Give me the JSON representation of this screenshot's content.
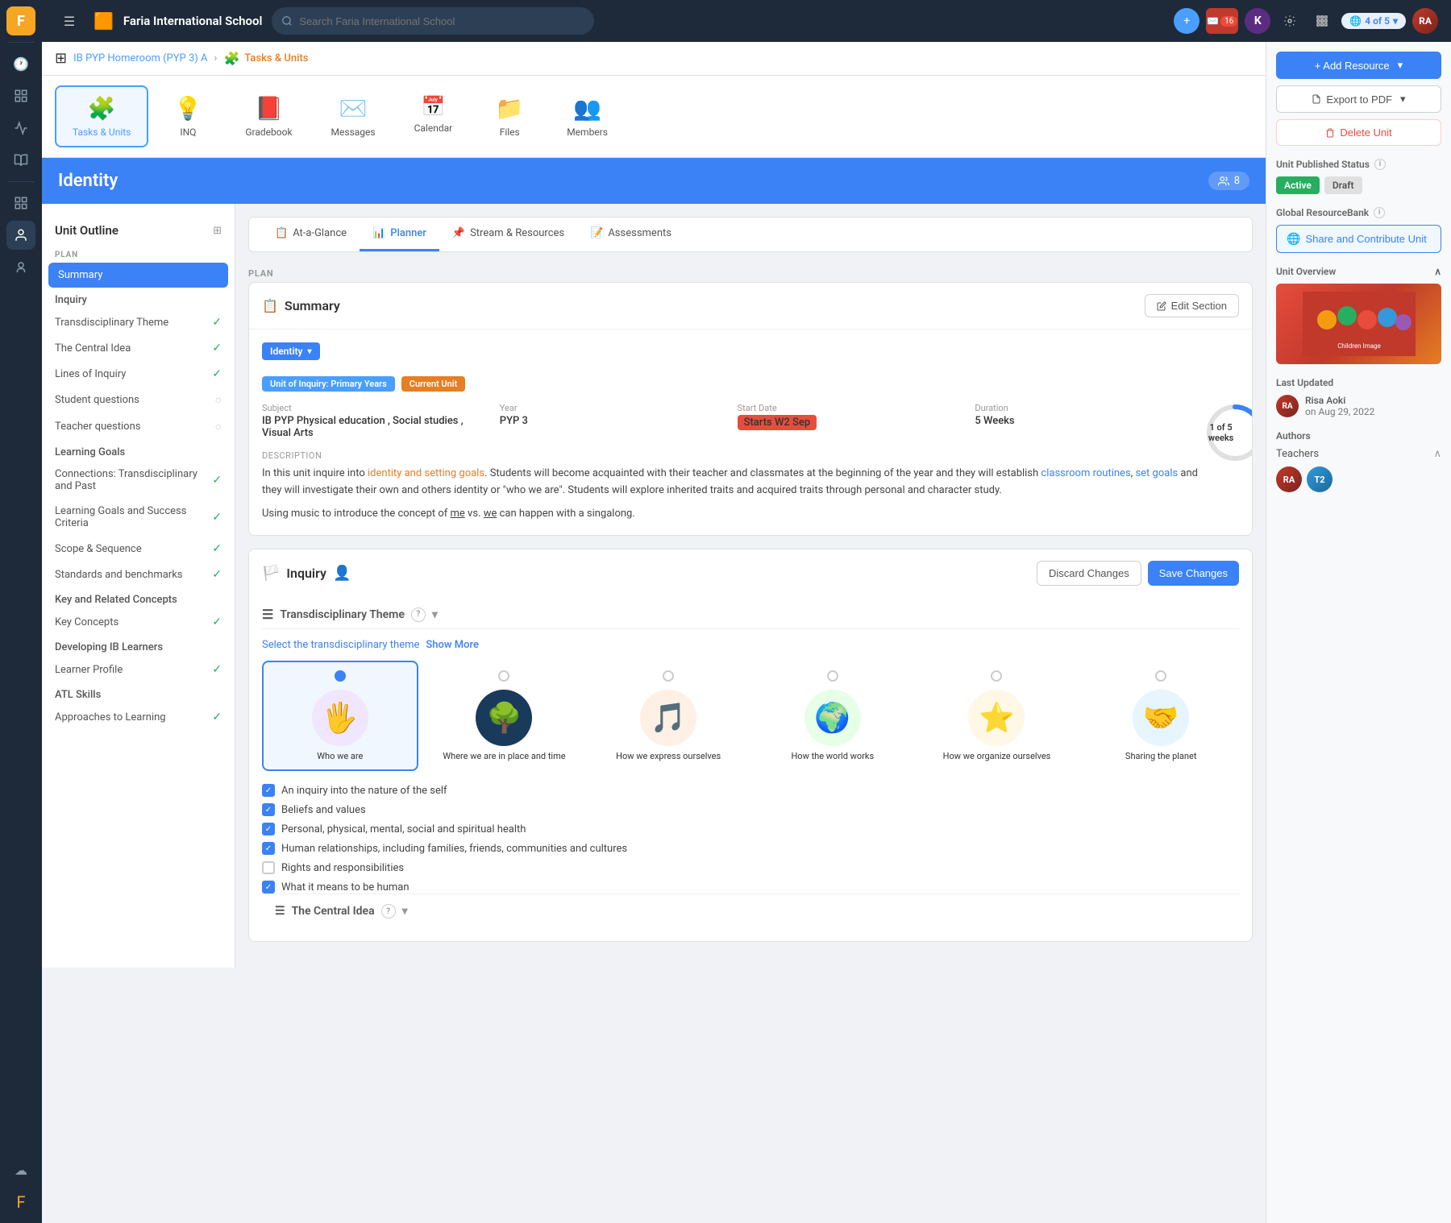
{
  "app": {
    "name": "Faria International School",
    "logo": "F"
  },
  "topbar": {
    "search_placeholder": "Search Faria International School",
    "notifications_count": "16",
    "version": "4 of 5"
  },
  "breadcrumb": {
    "parent": "IB PYP Homeroom (PYP 3) A",
    "current": "Tasks & Units"
  },
  "module_tabs": [
    {
      "id": "tasks-units",
      "label": "Tasks & Units",
      "icon": "🧩",
      "active": true
    },
    {
      "id": "inq",
      "label": "INQ",
      "icon": "💡",
      "active": false
    },
    {
      "id": "gradebook",
      "label": "Gradebook",
      "icon": "📕",
      "active": false
    },
    {
      "id": "messages",
      "label": "Messages",
      "icon": "✉️",
      "active": false
    },
    {
      "id": "calendar",
      "label": "Calendar",
      "icon": "📅",
      "active": false
    },
    {
      "id": "files",
      "label": "Files",
      "icon": "📁",
      "active": false
    },
    {
      "id": "members",
      "label": "Members",
      "icon": "👥",
      "active": false
    }
  ],
  "identity": {
    "title": "Identity",
    "members_count": "8"
  },
  "outline": {
    "title": "Unit Outline",
    "sections": {
      "plan": "PLAN",
      "items_plan": [
        {
          "id": "summary",
          "label": "Summary",
          "active": true,
          "check": "none"
        }
      ],
      "inquiry_label": "Inquiry",
      "inquiry_items": [
        {
          "id": "trans-theme",
          "label": "Transdisciplinary Theme",
          "check": "green"
        },
        {
          "id": "central-idea",
          "label": "The Central Idea",
          "check": "green"
        },
        {
          "id": "lines-inquiry",
          "label": "Lines of Inquiry",
          "check": "green"
        },
        {
          "id": "student-questions",
          "label": "Student questions",
          "check": "gray"
        },
        {
          "id": "teacher-questions",
          "label": "Teacher questions",
          "check": "gray"
        }
      ],
      "learning_goals_label": "Learning Goals",
      "learning_goals_items": [
        {
          "id": "connections",
          "label": "Connections: Transdisciplinary and Past",
          "check": "green"
        },
        {
          "id": "learning-goals",
          "label": "Learning Goals and Success Criteria",
          "check": "green"
        },
        {
          "id": "scope-sequence",
          "label": "Scope & Sequence",
          "check": "green"
        },
        {
          "id": "standards",
          "label": "Standards and benchmarks",
          "check": "green"
        }
      ],
      "key_related_label": "Key and Related Concepts",
      "key_items": [
        {
          "id": "key-concepts",
          "label": "Key Concepts",
          "check": "green"
        }
      ],
      "developing_ib_label": "Developing IB Learners",
      "developing_items": [
        {
          "id": "learner-profile",
          "label": "Learner Profile",
          "check": "green"
        }
      ],
      "atl_label": "ATL Skills",
      "atl_items": [
        {
          "id": "approaches",
          "label": "Approaches to Learning",
          "check": "green"
        }
      ]
    }
  },
  "sub_tabs": [
    {
      "id": "at-a-glance",
      "label": "At-a-Glance",
      "icon": "📋",
      "active": false
    },
    {
      "id": "planner",
      "label": "Planner",
      "icon": "📊",
      "active": true
    },
    {
      "id": "stream-resources",
      "label": "Stream & Resources",
      "icon": "📌",
      "active": false
    },
    {
      "id": "assessments",
      "label": "Assessments",
      "icon": "📝",
      "active": false
    }
  ],
  "summary_section": {
    "title": "Summary",
    "edit_button": "Edit Section",
    "identity_label": "Identity",
    "unit_badge": "Unit of Inquiry: Primary Years",
    "current_unit_badge": "Current Unit",
    "meta": {
      "subject_label": "Subject",
      "subject_value": "IB PYP Physical education , Social studies , Visual Arts",
      "year_label": "Year",
      "year_value": "PYP 3",
      "start_date_label": "Start Date",
      "start_date_value": "Starts W2 Sep",
      "duration_label": "Duration",
      "duration_value": "5 Weeks"
    },
    "progress": {
      "current": 1,
      "total": 5,
      "label": "weeks"
    },
    "description_label": "Description",
    "description_text": "In this unit inquire into identity and setting goals. Students will become acquainted with their teacher and classmates at the beginning of the year and they will establish classroom routines, set goals and they will investigate their own and others identity or \"who we are\". Students will explore inherited traits and acquired traits through personal and character study.",
    "description_text2": "Using music to introduce the concept of me vs. we can happen with a singalong."
  },
  "inquiry_section": {
    "title": "Inquiry",
    "discard_button": "Discard Changes",
    "save_button": "Save Changes",
    "trans_theme_label": "Transdisciplinary Theme",
    "select_text": "Select the transdisciplinary theme",
    "show_more": "Show More",
    "themes": [
      {
        "id": "who-we-are",
        "label": "Who we are",
        "selected": true,
        "color": "#f0e6ff"
      },
      {
        "id": "where-we-are",
        "label": "Where we are in place and time",
        "selected": false,
        "color": "#e6f0ff"
      },
      {
        "id": "how-express",
        "label": "How we express ourselves",
        "selected": false,
        "color": "#fff0e6"
      },
      {
        "id": "how-world",
        "label": "How the world works",
        "selected": false,
        "color": "#e6ffe6"
      },
      {
        "id": "how-organize",
        "label": "How we organize ourselves",
        "selected": false,
        "color": "#ffe6e6"
      },
      {
        "id": "sharing",
        "label": "Sharing the planet",
        "selected": false,
        "color": "#e6f5ff"
      }
    ],
    "checkboxes": [
      {
        "id": "cb1",
        "label": "An inquiry into the nature of the self",
        "checked": true
      },
      {
        "id": "cb2",
        "label": "Beliefs and values",
        "checked": true
      },
      {
        "id": "cb3",
        "label": "Personal, physical, mental, social and spiritual health",
        "checked": true
      },
      {
        "id": "cb4",
        "label": "Human relationships, including families, friends, communities and cultures",
        "checked": true
      },
      {
        "id": "cb5",
        "label": "Rights and responsibilities",
        "checked": false
      },
      {
        "id": "cb6",
        "label": "What it means to be human",
        "checked": true
      }
    ],
    "central_idea_label": "The Central Idea"
  },
  "right_panel": {
    "add_resource_button": "+ Add Resource",
    "export_pdf_button": "Export to PDF",
    "delete_unit_button": "Delete Unit",
    "unit_published_label": "Unit Published Status",
    "status_active": "Active",
    "status_draft": "Draft",
    "global_resource_label": "Global ResourceBank",
    "share_contribute_button": "Share and Contribute Unit",
    "unit_overview_label": "Unit Overview",
    "last_updated_label": "Last Updated",
    "last_updated_author": "Risa Aoki",
    "last_updated_date": "on Aug 29, 2022",
    "authors_label": "Authors",
    "authors_type": "Teachers"
  },
  "left_nav_icons": [
    {
      "id": "hamburger",
      "icon": "☰",
      "active": false
    },
    {
      "id": "clock",
      "icon": "🕐",
      "active": false
    },
    {
      "id": "home",
      "icon": "⊞",
      "active": false
    },
    {
      "id": "chart",
      "icon": "📈",
      "active": false
    },
    {
      "id": "book",
      "icon": "📚",
      "active": false
    },
    {
      "id": "grid",
      "icon": "⊞",
      "active": false
    },
    {
      "id": "user-circle",
      "icon": "👤",
      "active": true
    },
    {
      "id": "person",
      "icon": "🧑",
      "active": false
    },
    {
      "id": "cloud",
      "icon": "☁",
      "active": false
    },
    {
      "id": "faria",
      "icon": "F",
      "active": false
    }
  ]
}
